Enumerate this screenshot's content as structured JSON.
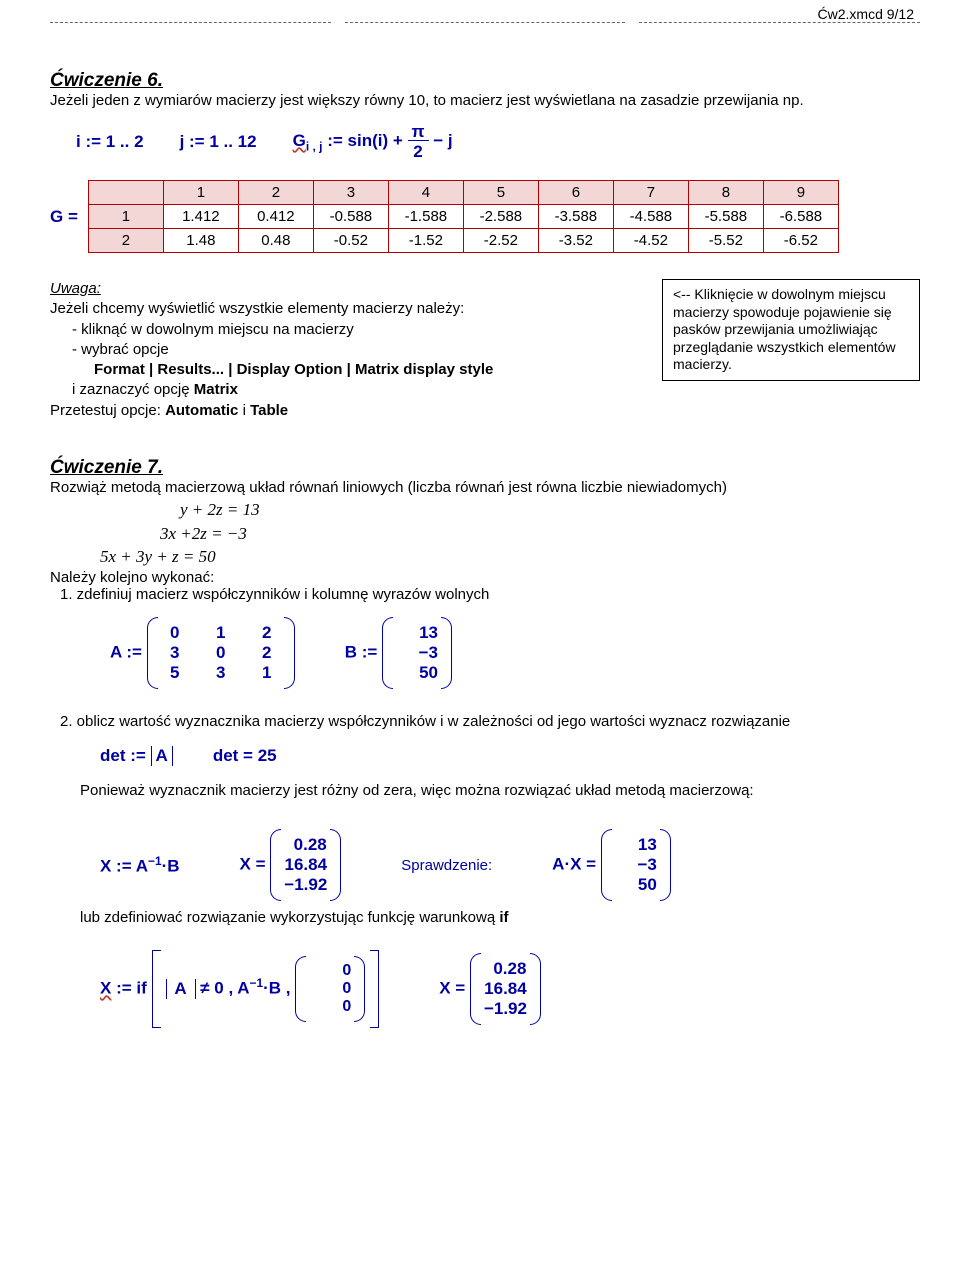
{
  "header": {
    "file": "Ćw2.xmcd 9/12"
  },
  "ex6": {
    "title": "Ćwiczenie 6.",
    "desc": "Jeżeli jeden z wymiarów macierzy jest większy równy 10, to macierz jest wyświetlana na zasadzie przewijania np.",
    "i_def": "i := 1 .. 2",
    "j_def": "j := 1 .. 12",
    "G_lhs": "G",
    "G_sub": "i , j",
    "G_assign": " := sin(i) + ",
    "G_frac_num": "π",
    "G_frac_den": "2",
    "G_trail": " − j",
    "G_eq": "G =",
    "table": {
      "cols": [
        "1",
        "2",
        "3",
        "4",
        "5",
        "6",
        "7",
        "8",
        "9"
      ],
      "rows": [
        {
          "h": "1",
          "v": [
            "1.412",
            "0.412",
            "-0.588",
            "-1.588",
            "-2.588",
            "-3.588",
            "-4.588",
            "-5.588",
            "-6.588"
          ]
        },
        {
          "h": "2",
          "v": [
            "1.48",
            "0.48",
            "-0.52",
            "-1.52",
            "-2.52",
            "-3.52",
            "-4.52",
            "-5.52",
            "-6.52"
          ]
        }
      ]
    },
    "uwaga": {
      "ttl": "Uwaga:",
      "l1": "Jeżeli chcemy wyświetlić wszystkie elementy macierzy należy:",
      "l2": "- kliknąć w dowolnym miejscu na macierzy",
      "l3": "- wybrać opcje",
      "l4a": "Format | Results... | Display Option | Matrix display style",
      "l5a": "i zaznaczyć opcję ",
      "l5b": "Matrix",
      "l6a": "Przetestuj opcje: ",
      "l6b": "Automatic",
      "l6c": " i ",
      "l6d": "Table"
    },
    "note": "<-- Kliknięcie w dowolnym miejscu macierzy spowoduje pojawienie się pasków przewijania umożliwiając przeglądanie wszystkich elementów macierzy."
  },
  "ex7": {
    "title": "Ćwiczenie 7.",
    "desc": "Rozwiąż metodą macierzową układ równań liniowych (liczba równań jest równa liczbie niewiadomych)",
    "eq1": "y  +  2z  =  13",
    "eq2": "3x  +2z  =  −3",
    "eq3": "5x  +  3y  +  z  =  50",
    "after_eqs": "Należy kolejno wykonać:",
    "step1": "1. zdefiniuj macierz współczynników i kolumnę wyrazów wolnych",
    "A_lbl": "A := ",
    "B_lbl": "B := ",
    "A": [
      [
        "0",
        "1",
        "2"
      ],
      [
        "3",
        "0",
        "2"
      ],
      [
        "5",
        "3",
        "1"
      ]
    ],
    "B": [
      [
        "13"
      ],
      [
        "−3"
      ],
      [
        "50"
      ]
    ],
    "step2": "2. oblicz wartość wyznacznika macierzy współczynników i w zależności od jego wartości wyznacz rozwiązanie",
    "det_def": "det := ",
    "det_abs": "A",
    "det_res": "det = 25",
    "since": "Ponieważ wyznacznik macierzy jest różny od zera, więc można rozwiązać układ metodą macierzową:",
    "Xdef": "X := A",
    "Xdef_sup": "−1",
    "Xdef_tail": "·B",
    "X_eq": "X = ",
    "X_vals": [
      [
        "0.28"
      ],
      [
        "16.84"
      ],
      [
        "−1.92"
      ]
    ],
    "spraw": "Sprawdzenie:",
    "AX_eq": "A·X = ",
    "AX_vals": [
      [
        "13"
      ],
      [
        "−3"
      ],
      [
        "50"
      ]
    ],
    "or": "lub zdefiniować rozwiązanie wykorzystując funkcję warunkową ",
    "or_if": "if",
    "Xif_lhs": "X",
    "Xif_assign": " := if",
    "Xif_body1": "A",
    "Xif_body2": " ≠ 0 , A",
    "Xif_sup": "−1",
    "Xif_body3": "·B , ",
    "zero_col": [
      [
        "0"
      ],
      [
        "0"
      ],
      [
        "0"
      ]
    ],
    "X2_eq": "X = ",
    "X2_vals": [
      [
        "0.28"
      ],
      [
        "16.84"
      ],
      [
        "−1.92"
      ]
    ]
  }
}
